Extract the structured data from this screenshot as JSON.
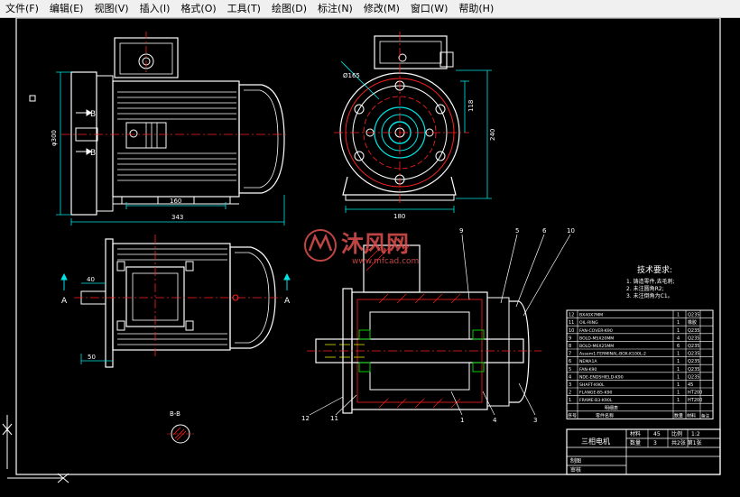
{
  "menubar": {
    "items": [
      {
        "label": "文件(F)"
      },
      {
        "label": "编辑(E)"
      },
      {
        "label": "视图(V)"
      },
      {
        "label": "插入(I)"
      },
      {
        "label": "格式(O)"
      },
      {
        "label": "工具(T)"
      },
      {
        "label": "绘图(D)"
      },
      {
        "label": "标注(N)"
      },
      {
        "label": "修改(M)"
      },
      {
        "label": "窗口(W)"
      },
      {
        "label": "帮助(H)"
      }
    ]
  },
  "drawing": {
    "dims": {
      "dia_300": "φ300",
      "dia_165": "Ø165",
      "h_118": "118",
      "h_240": "240",
      "w_180": "180",
      "w_160": "160",
      "w_343": "343",
      "w_40": "40",
      "w_50": "50"
    },
    "section_marks": {
      "b_upper": "B",
      "b_lower": "B",
      "a_left": "A",
      "a_right": "A",
      "bb_label": "B-B"
    },
    "watermark": {
      "title": "沐风网",
      "url": "www.mfcad.com"
    },
    "callouts": [
      "9",
      "5",
      "6",
      "10",
      "12",
      "11",
      "1",
      "4",
      "3"
    ],
    "tech_title": "技术要求:",
    "tech_notes": [
      "1. 铸造零件,去毛刺;",
      "2. 未注圆角R2;",
      "3. 未注倒角为C1。"
    ]
  },
  "parts_list": {
    "rows": [
      {
        "no": "12",
        "name": "BX40X7MM",
        "qty": "1",
        "mat": "Q235"
      },
      {
        "no": "11",
        "name": "OIL-RING",
        "qty": "1",
        "mat": "橡胶"
      },
      {
        "no": "10",
        "name": "FAN-COVER-K90",
        "qty": "1",
        "mat": "Q235"
      },
      {
        "no": "9",
        "name": "BOLD-M5X20MM",
        "qty": "4",
        "mat": "Q235"
      },
      {
        "no": "8",
        "name": "BOLD-M6X25MM",
        "qty": "6",
        "mat": "Q235"
      },
      {
        "no": "7",
        "name": "Assem1-TERMINAL-BOX-K100L-2",
        "qty": "1",
        "mat": "Q235"
      },
      {
        "no": "6",
        "name": "NEMA1A",
        "qty": "1",
        "mat": "Q235"
      },
      {
        "no": "5",
        "name": "FAN-K90",
        "qty": "1",
        "mat": "Q235"
      },
      {
        "no": "4",
        "name": "NDE-ENDSHIELD-K90",
        "qty": "1",
        "mat": "Q235"
      },
      {
        "no": "3",
        "name": "SHAFT-K90L",
        "qty": "1",
        "mat": "45"
      },
      {
        "no": "2",
        "name": "FLANGE-B5-K90",
        "qty": "1",
        "mat": "HT200"
      },
      {
        "no": "1",
        "name": "FRAME-B3-K90L",
        "qty": "1",
        "mat": "HT200"
      }
    ],
    "header": {
      "no": "序号",
      "name": "零件名称",
      "qty": "数量",
      "mat": "材料",
      "note": "备注"
    },
    "section_title": "明细表"
  },
  "title_block": {
    "title": "三相电机",
    "material_label": "材料",
    "material_value": "45",
    "scale_label": "比例",
    "scale_value": "1:2",
    "qty_label": "数量",
    "qty_value": "3",
    "sheets": "共2张 第1张",
    "drawn_label": "制图",
    "checked_label": "审核"
  },
  "colors": {
    "menubar_bg": "#f0f0f0",
    "canvas_bg": "#000000",
    "line_white": "#ffffff",
    "line_cyan": "#00e5e5",
    "line_red": "#ff2020",
    "line_yellow": "#ffff00",
    "line_green": "#00cc00",
    "watermark": "#e05050"
  }
}
